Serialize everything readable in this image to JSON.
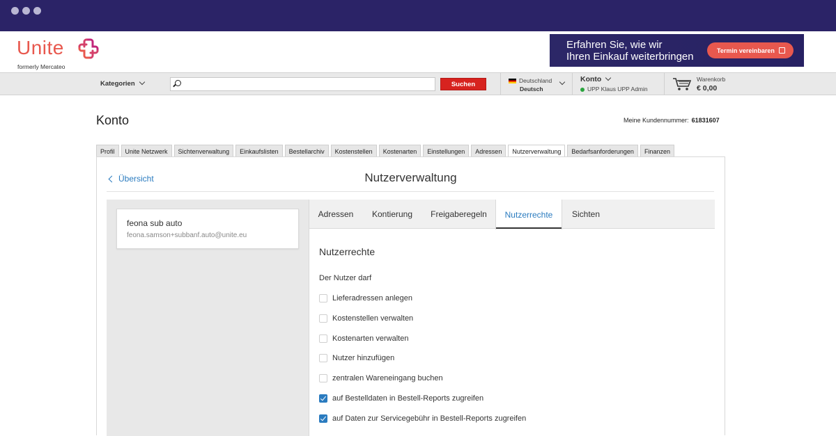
{
  "header": {
    "logo_text": "Unite",
    "logo_sub": "formerly Mercateo",
    "banner_line1": "Erfahren Sie, wie wir",
    "banner_line2": "Ihren Einkauf weiterbringen",
    "banner_button": "Termin vereinbaren"
  },
  "navbar": {
    "categories": "Kategorien",
    "search_placeholder": "",
    "search_button": "Suchen",
    "country": "Deutschland",
    "language": "Deutsch",
    "account_label": "Konto",
    "account_user": "UPP Klaus UPP Admin",
    "cart_label": "Warenkorb",
    "cart_value": "€ 0,00"
  },
  "page": {
    "title": "Konto",
    "customer_number_label": "Meine Kundennummer:",
    "customer_number": "61831607",
    "tabs": [
      {
        "label": "Profil"
      },
      {
        "label": "Unite Netzwerk"
      },
      {
        "label": "Sichtenverwaltung"
      },
      {
        "label": "Einkaufslisten"
      },
      {
        "label": "Bestellarchiv"
      },
      {
        "label": "Kostenstellen"
      },
      {
        "label": "Kostenarten"
      },
      {
        "label": "Einstellungen"
      },
      {
        "label": "Adressen"
      },
      {
        "label": "Nutzerverwaltung"
      },
      {
        "label": "Bedarfsanforderungen"
      },
      {
        "label": "Finanzen"
      }
    ],
    "active_tab": "Nutzerverwaltung"
  },
  "panel": {
    "back_label": "Übersicht",
    "title": "Nutzerverwaltung",
    "user": {
      "name": "feona sub auto",
      "email": "feona.samson+subbanf.auto@unite.eu"
    },
    "subtabs": [
      {
        "label": "Adressen"
      },
      {
        "label": "Kontierung"
      },
      {
        "label": "Freigaberegeln"
      },
      {
        "label": "Nutzerrechte"
      },
      {
        "label": "Sichten"
      }
    ],
    "active_subtab": "Nutzerrechte",
    "section_title": "Nutzerrechte",
    "intro": "Der Nutzer darf",
    "permissions": [
      {
        "label": "Lieferadressen anlegen",
        "checked": false
      },
      {
        "label": "Kostenstellen verwalten",
        "checked": false
      },
      {
        "label": "Kostenarten verwalten",
        "checked": false
      },
      {
        "label": "Nutzer hinzufügen",
        "checked": false
      },
      {
        "label": "zentralen Wareneingang buchen",
        "checked": false
      },
      {
        "label": "auf Bestelldaten in Bestell-Reports zugreifen",
        "checked": true
      },
      {
        "label": "auf Daten zur Servicegebühr in Bestell-Reports zugreifen",
        "checked": true
      }
    ]
  },
  "colors": {
    "titlebar": "#2b2367",
    "brand": "#e8584e",
    "accent": "#2a7bbf",
    "search_button": "#d7231f"
  }
}
